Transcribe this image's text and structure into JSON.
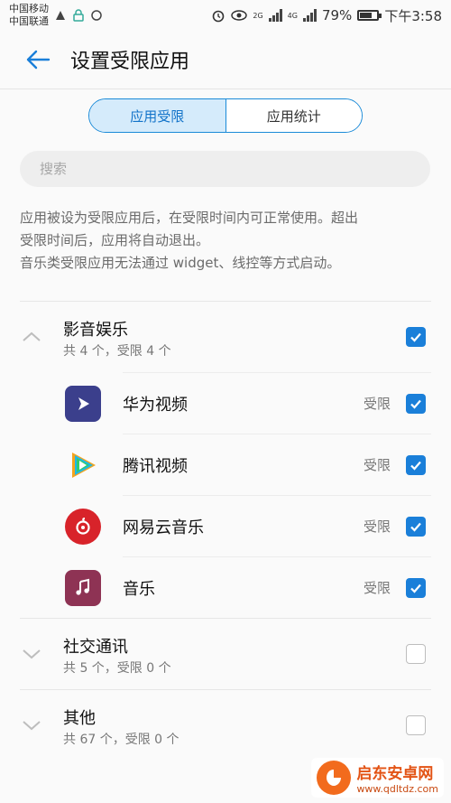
{
  "status_bar": {
    "carrier1": "中国移动",
    "carrier2": "中国联通",
    "net1": "2G",
    "net2": "4G",
    "battery": "79%",
    "battery_level": 0.79,
    "time": "下午3:58"
  },
  "app_bar": {
    "title": "设置受限应用",
    "back_icon": "arrow-left-icon"
  },
  "segment": {
    "tab1": "应用受限",
    "tab2": "应用统计",
    "selected": "应用受限"
  },
  "search": {
    "placeholder": "搜索",
    "value": ""
  },
  "description": {
    "line1": "应用被设为受限应用后，在受限时间内可正常使用。超出",
    "line2": "受限时间后，应用将自动退出。",
    "line3": "音乐类受限应用无法通过 widget、线控等方式启动。"
  },
  "groups": [
    {
      "name": "影音娱乐",
      "summary": "共 4 个，受限 4 个",
      "expanded": true,
      "checked": true,
      "apps": [
        {
          "name": "华为视频",
          "status": "受限",
          "checked": true,
          "icon": "huawei-video-icon"
        },
        {
          "name": "腾讯视频",
          "status": "受限",
          "checked": true,
          "icon": "tencent-video-icon"
        },
        {
          "name": "网易云音乐",
          "status": "受限",
          "checked": true,
          "icon": "netease-music-icon"
        },
        {
          "name": "音乐",
          "status": "受限",
          "checked": true,
          "icon": "music-icon"
        }
      ]
    },
    {
      "name": "社交通讯",
      "summary": "共 5 个，受限 0 个",
      "expanded": false,
      "checked": false
    },
    {
      "name": "其他",
      "summary": "共 67 个，受限 0 个",
      "expanded": false,
      "checked": false
    }
  ],
  "watermark": {
    "name": "启东安卓网",
    "url": "www.qdltdz.com"
  },
  "colors": {
    "accent": "#1a7fd9",
    "segment_active_bg": "#d5ebfb"
  }
}
